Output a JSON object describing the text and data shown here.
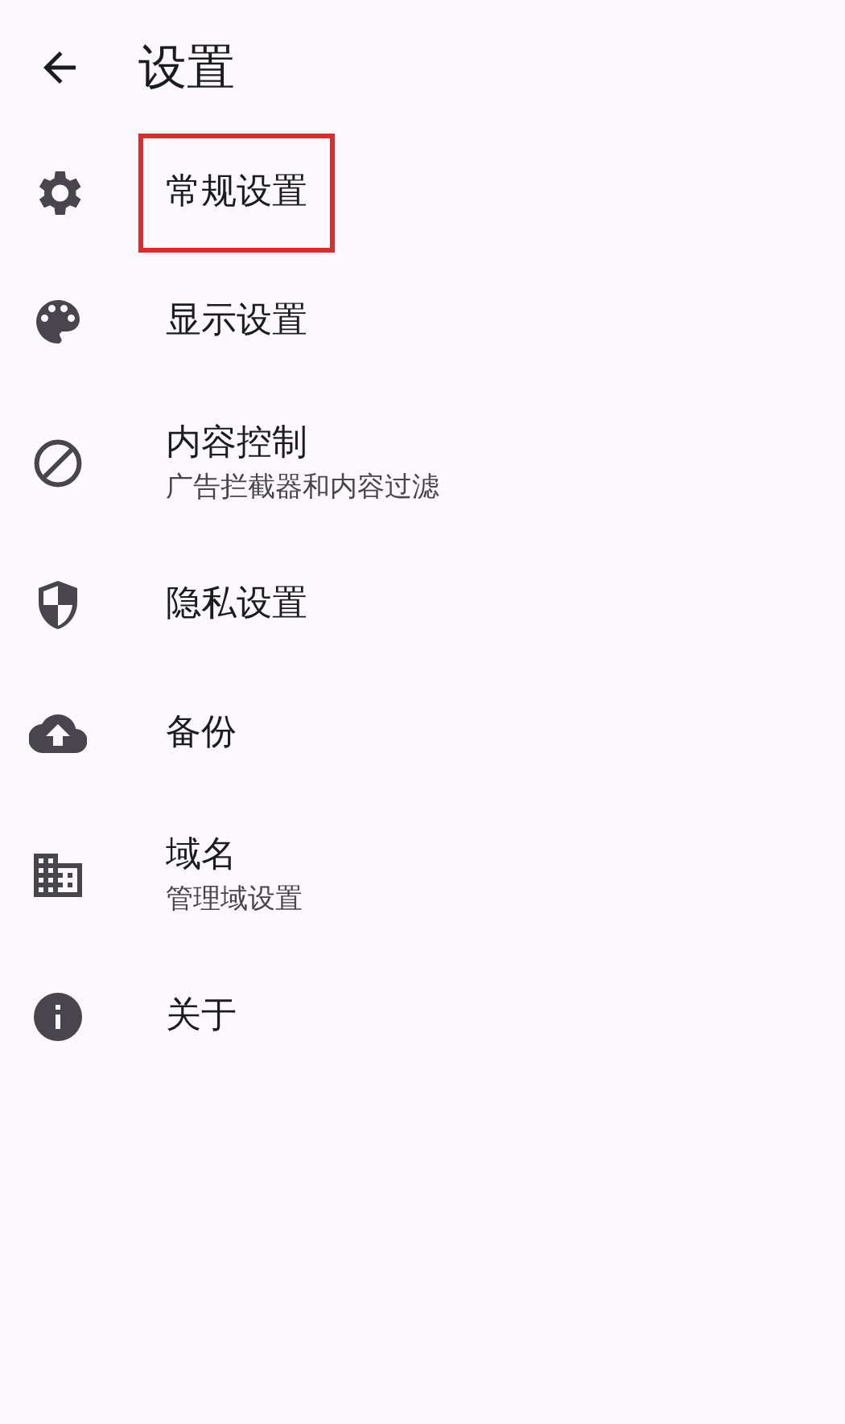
{
  "header": {
    "title": "设置"
  },
  "items": [
    {
      "title": "常规设置",
      "highlighted": true
    },
    {
      "title": "显示设置",
      "highlighted": false
    },
    {
      "title": "内容控制",
      "subtitle": "广告拦截器和内容过滤",
      "highlighted": false
    },
    {
      "title": "隐私设置",
      "highlighted": false
    },
    {
      "title": "备份",
      "highlighted": false
    },
    {
      "title": "域名",
      "subtitle": "管理域设置",
      "highlighted": false
    },
    {
      "title": "关于",
      "highlighted": false
    }
  ]
}
